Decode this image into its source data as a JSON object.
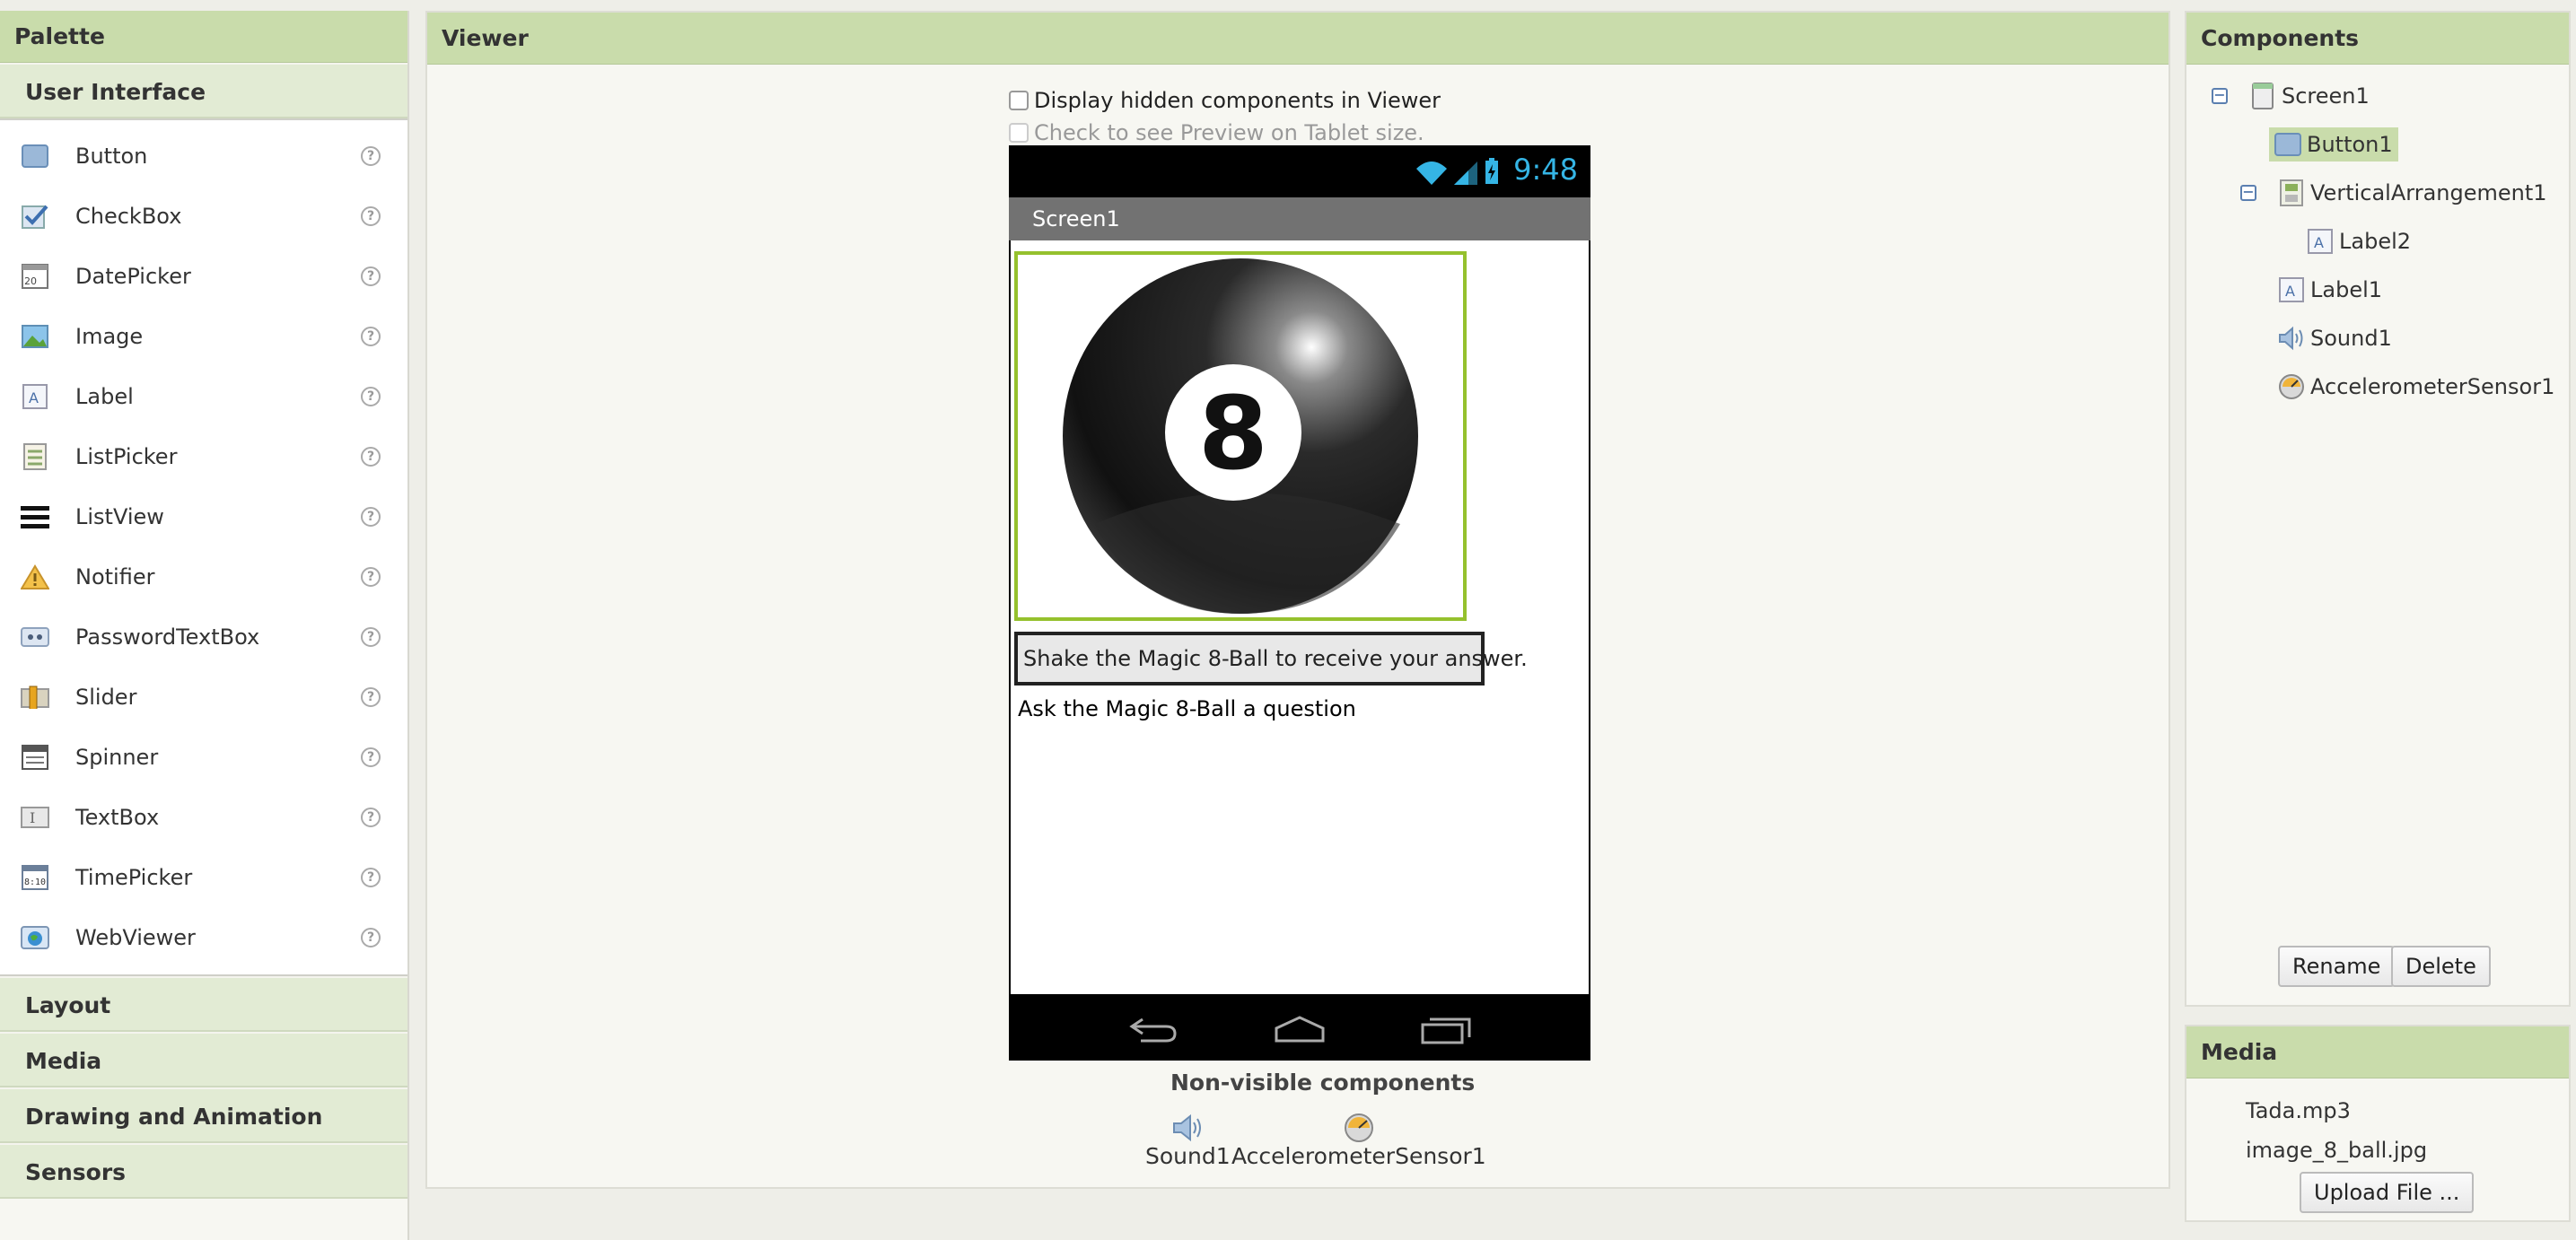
{
  "palette": {
    "title": "Palette",
    "drawers": {
      "user_interface": "User Interface",
      "layout": "Layout",
      "media": "Media",
      "drawing": "Drawing and Animation",
      "sensors": "Sensors"
    },
    "items": [
      {
        "label": "Button",
        "icon": "button-icon"
      },
      {
        "label": "CheckBox",
        "icon": "checkbox-icon"
      },
      {
        "label": "DatePicker",
        "icon": "datepicker-icon"
      },
      {
        "label": "Image",
        "icon": "image-icon"
      },
      {
        "label": "Label",
        "icon": "label-icon"
      },
      {
        "label": "ListPicker",
        "icon": "listpicker-icon"
      },
      {
        "label": "ListView",
        "icon": "listview-icon"
      },
      {
        "label": "Notifier",
        "icon": "notifier-icon"
      },
      {
        "label": "PasswordTextBox",
        "icon": "passwordtextbox-icon"
      },
      {
        "label": "Slider",
        "icon": "slider-icon"
      },
      {
        "label": "Spinner",
        "icon": "spinner-icon"
      },
      {
        "label": "TextBox",
        "icon": "textbox-icon"
      },
      {
        "label": "TimePicker",
        "icon": "timepicker-icon"
      },
      {
        "label": "WebViewer",
        "icon": "webviewer-icon"
      }
    ],
    "help_glyph": "?"
  },
  "viewer": {
    "title": "Viewer",
    "hidden_checkbox_label": "Display hidden components in Viewer",
    "tablet_checkbox_label": "Check to see Preview on Tablet size.",
    "phone": {
      "clock": "9:48",
      "screen_title": "Screen1",
      "ball_number": "8",
      "button_text": "Shake the Magic 8-Ball to receive your answer.",
      "label_text": "Ask the Magic 8-Ball a question"
    },
    "nonvisible_title": "Non-visible components",
    "nonvisible": [
      {
        "label": "Sound1",
        "icon": "speaker-icon"
      },
      {
        "label": "AccelerometerSensor1",
        "icon": "accelerometer-icon"
      }
    ]
  },
  "components": {
    "title": "Components",
    "tree": {
      "screen1": "Screen1",
      "button1": "Button1",
      "vertical_arrangement1": "VerticalArrangement1",
      "label2": "Label2",
      "label1": "Label1",
      "sound1": "Sound1",
      "accelerometer1": "AccelerometerSensor1"
    },
    "collapse_glyph": "−",
    "rename_label": "Rename",
    "delete_label": "Delete"
  },
  "media": {
    "title": "Media",
    "files": [
      "Tada.mp3",
      "image_8_ball.jpg"
    ],
    "upload_label": "Upload File ..."
  },
  "colors": {
    "panel_header": "#c9dcab",
    "selection": "#c9dcab",
    "image_border": "#95c12d",
    "clock": "#35b5e5"
  }
}
